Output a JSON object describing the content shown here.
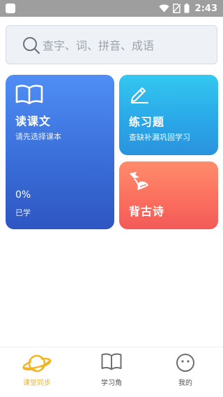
{
  "status_bar": {
    "time": "2:43"
  },
  "search": {
    "placeholder": "查字、词、拼音、成语"
  },
  "cards": {
    "read": {
      "title": "读课文",
      "subtitle": "请先选择课本",
      "progress": "0%",
      "progress_label": "已学"
    },
    "practice": {
      "title": "练习题",
      "subtitle": "查缺补漏巩固学习"
    },
    "poem": {
      "title": "背古诗"
    }
  },
  "bottom_nav": {
    "items": [
      {
        "label": "课堂同步",
        "icon": "planet-icon",
        "active": true
      },
      {
        "label": "学习角",
        "icon": "book-icon",
        "active": false
      },
      {
        "label": "我的",
        "icon": "smiley-icon",
        "active": false
      }
    ]
  },
  "colors": {
    "accent": "#f2b425",
    "read_card": "#3a6ed8",
    "practice_card": "#2aa6e8",
    "poem_card": "#fb6d5e"
  }
}
